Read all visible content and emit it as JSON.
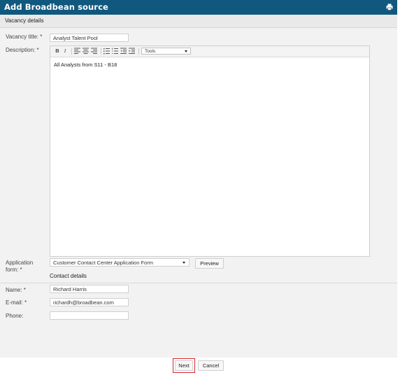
{
  "window": {
    "title": "Add Broadbean source",
    "print_icon": "printer-icon"
  },
  "sections": {
    "vacancy_details": "Vacancy details",
    "contact_details": "Contact details"
  },
  "form": {
    "vacancy_title": {
      "label": "Vacancy title: *",
      "value": "Analyst Talent Pool"
    },
    "description": {
      "label": "Description: *",
      "content": "All Analysts from S11 - B18",
      "toolbar": {
        "bold": "B",
        "italic": "I",
        "tools_label": "Tools"
      }
    },
    "application_form": {
      "label": "Application form: *",
      "value": "Customer Contact Center Application Form",
      "preview_label": "Preview"
    },
    "name": {
      "label": "Name: *",
      "value": "Richard Harris"
    },
    "email": {
      "label": "E-mail: *",
      "value": "richardh@broadbean.com"
    },
    "phone": {
      "label": "Phone:",
      "value": ""
    }
  },
  "buttons": {
    "next": "Next",
    "cancel": "Cancel"
  },
  "colors": {
    "titlebar": "#10587e",
    "highlight": "#d2262c"
  }
}
